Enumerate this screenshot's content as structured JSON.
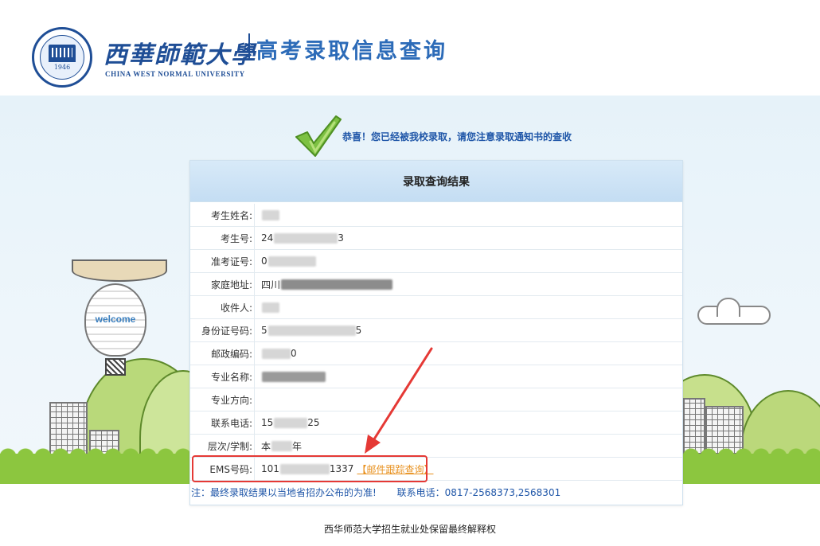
{
  "header": {
    "school_name_cn": "西華師範大學",
    "school_name_en": "CHINA WEST NORMAL UNIVERSITY",
    "seal_year": "1946",
    "system_title": "高考录取信息查询"
  },
  "decor": {
    "balloon_label": "welcome"
  },
  "notice": {
    "text": "恭喜！您已经被我校录取，请您注意录取通知书的查收",
    "icon": "check-icon"
  },
  "card": {
    "title": "录取查询结果",
    "rows": [
      {
        "label": "考生姓名:",
        "visible": "",
        "masked": true
      },
      {
        "label": "考生号:",
        "visible": "24",
        "tail": "3",
        "masked": true
      },
      {
        "label": "准考证号:",
        "visible": "0",
        "masked": true
      },
      {
        "label": "家庭地址:",
        "visible": "四川",
        "masked": true
      },
      {
        "label": "收件人:",
        "visible": "",
        "masked": true
      },
      {
        "label": "身份证号码:",
        "visible": "5",
        "tail": "5",
        "masked": true
      },
      {
        "label": "邮政编码:",
        "visible": "",
        "tail": "0",
        "masked": true
      },
      {
        "label": "专业名称:",
        "visible": "",
        "masked": true
      },
      {
        "label": "专业方向:",
        "visible": "",
        "masked": false
      },
      {
        "label": "联系电话:",
        "visible": "15",
        "tail": "25",
        "masked": true
      },
      {
        "label": "层次/学制:",
        "visible": "本",
        "tail": "年",
        "masked": true
      },
      {
        "label": "EMS号码:",
        "visible": "101",
        "tail": "1337",
        "masked": true
      }
    ],
    "ems_track_link": "【邮件跟踪查询】"
  },
  "note": {
    "text": "注：最终录取结果以当地省招办公布的为准!",
    "phone": "联系电话：0817-2568373,2568301"
  },
  "footer": {
    "text": "西华师范大学招生就业处保留最终解释权"
  },
  "colors": {
    "brand_blue": "#1f4e96",
    "link_orange": "#e8911f",
    "highlight_red": "#e53935"
  }
}
